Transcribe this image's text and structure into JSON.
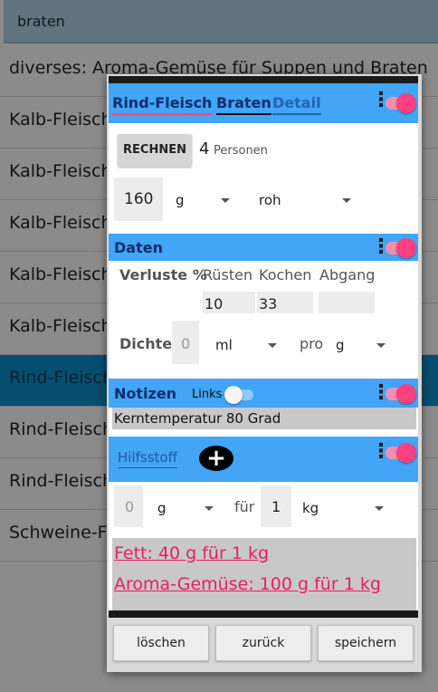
{
  "search": {
    "value": "braten"
  },
  "list": [
    {
      "label": "diverses: Aroma-Gemüse für Suppen und Braten"
    },
    {
      "label": "Kalb-Fleisch"
    },
    {
      "label": "Kalb-Fleisch"
    },
    {
      "label": "Kalb-Fleisch"
    },
    {
      "label": "Kalb-Fleisch"
    },
    {
      "label": "Kalb-Fleisch"
    },
    {
      "label": "Rind-Fleisch"
    },
    {
      "label": "Rind-Fleisch"
    },
    {
      "label": "Rind-Fleisch"
    },
    {
      "label": "Schweine-Fleisch"
    }
  ],
  "dialog": {
    "tabs": {
      "item": "Rind-Fleisch",
      "cut": "Braten",
      "detail": "Detail"
    },
    "calc": {
      "button": "RECHNEN",
      "persons_value": "4",
      "persons_label": "Personen",
      "amount": "160",
      "unit": "g",
      "state": "roh"
    },
    "daten": {
      "title": "Daten",
      "verluste_label": "Verluste %",
      "col_ruesten": "Rüsten",
      "col_kochen": "Kochen",
      "col_abgang": "Abgang",
      "val_ruesten": "10",
      "val_kochen": "33",
      "val_abgang": "",
      "dichte_label": "Dichte",
      "dichte_value": "0",
      "dichte_unit": "ml",
      "pro_label": "pro",
      "pro_unit": "g"
    },
    "notizen": {
      "title": "Notizen",
      "links_label": "Links",
      "text": "Kerntemperatur 80 Grad"
    },
    "hilfsstoff": {
      "placeholder": "Hilfsstoff",
      "amount": "0",
      "unit": "g",
      "fuer_label": "für",
      "per_value": "1",
      "per_unit": "kg"
    },
    "results": [
      "Fett: 40 g für 1 kg",
      "Aroma-Gemüse: 100 g für 1 kg"
    ],
    "buttons": {
      "delete": "löschen",
      "back": "zurück",
      "save": "speichern"
    }
  },
  "colors": {
    "header_blue": "#42a5f5",
    "accent_pink": "#ff4081",
    "selected_row": "#0b87bf"
  },
  "toggles": {
    "main": true,
    "daten": true,
    "notizen": true,
    "links": false,
    "hilfsstoff": true
  }
}
